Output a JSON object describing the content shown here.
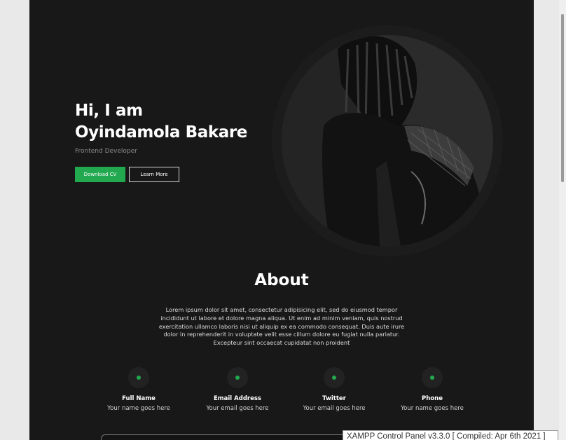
{
  "hero": {
    "greeting": "Hi, I am",
    "name": "Oyindamola Bakare",
    "role": "Frontend Developer",
    "primary_button": "Download CV",
    "secondary_button": "Learn More"
  },
  "about": {
    "title": "About",
    "text": "Lorem ipsum dolor sit amet, consectetur adipisicing elit, sed do eiusmod tempor incididunt ut labore et dolore magna aliqua. Ut enim ad minim veniam, quis nostrud exercitation ullamco laboris nisi ut aliquip ex ea commodo consequat. Duis aute irure dolor in reprehenderit in voluptate velit esse cillum dolore eu fugiat nulla pariatur. Excepteur sint occaecat cupidatat non proident"
  },
  "contacts": [
    {
      "label": "Full Name",
      "value": "Your name goes here"
    },
    {
      "label": "Email Address",
      "value": "Your email goes here"
    },
    {
      "label": "Twitter",
      "value": "Your email goes here"
    },
    {
      "label": "Phone",
      "value": "Your name goes here"
    }
  ],
  "taskbar_tooltip": "XAMPP Control Panel v3.3.0   [ Compiled: Apr 6th 2021 ]",
  "colors": {
    "page_background": "#181818",
    "accent": "#22a84f",
    "outer_background": "#e9e9e9"
  },
  "icons": {
    "contact_marker": "green-dot-icon",
    "portrait": "profile-photo"
  }
}
